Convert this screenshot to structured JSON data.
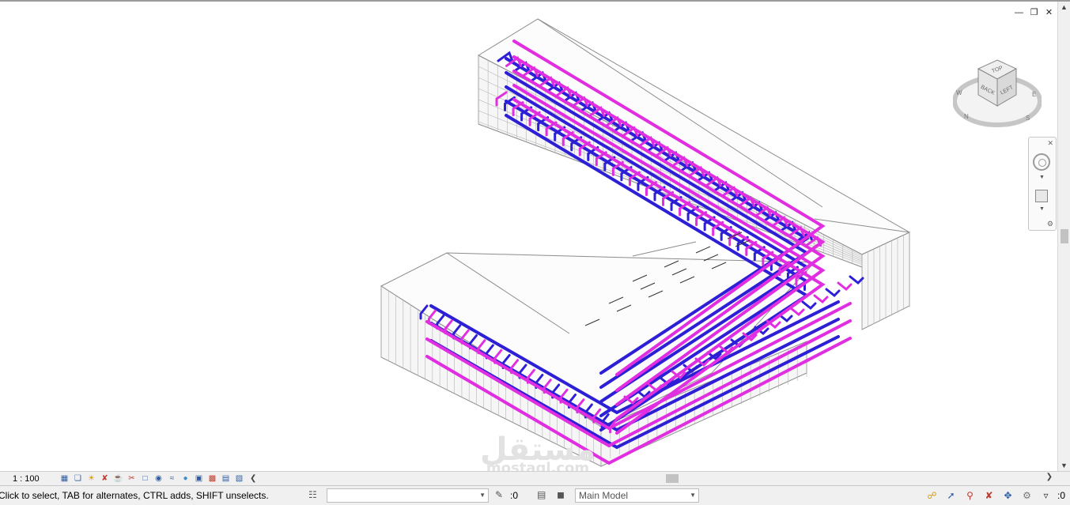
{
  "window": {
    "controls": [
      "minimize-icon",
      "restore-icon",
      "close-icon"
    ]
  },
  "viewcube": {
    "faces": {
      "top": "TOP",
      "back": "BACK",
      "left": "LEFT"
    },
    "compass": [
      "N",
      "W",
      "S",
      "E"
    ]
  },
  "view_control_bar": {
    "scale": "1 : 100",
    "icons": [
      "detail-level-icon",
      "visual-style-icon",
      "sun-path-icon",
      "shadows-icon",
      "render-icon",
      "crop-view-icon",
      "show-crop-icon",
      "temporary-hide-icon",
      "reveal-hidden-icon",
      "temporary-view-properties-icon",
      "highlight-displacement-icon",
      "reveal-constraints-icon",
      "worksharing-display-icon",
      "analytical-model-icon",
      "show-model-icon",
      "collapse-icon"
    ]
  },
  "status_bar": {
    "message": "Click to select, TAB for alternates, CTRL adds, SHIFT unselects.",
    "worksets_value": "",
    "design_option_count": ":0",
    "model_dropdown": "Main Model",
    "filter_count": ":0"
  },
  "watermark": {
    "arabic": "مستقل",
    "latin": "mostaql.com"
  },
  "colors": {
    "supply_duct": "#2c1fd6",
    "return_duct": "#e02ee0",
    "building_lines": "#8c8c8c",
    "background": "#ffffff"
  }
}
